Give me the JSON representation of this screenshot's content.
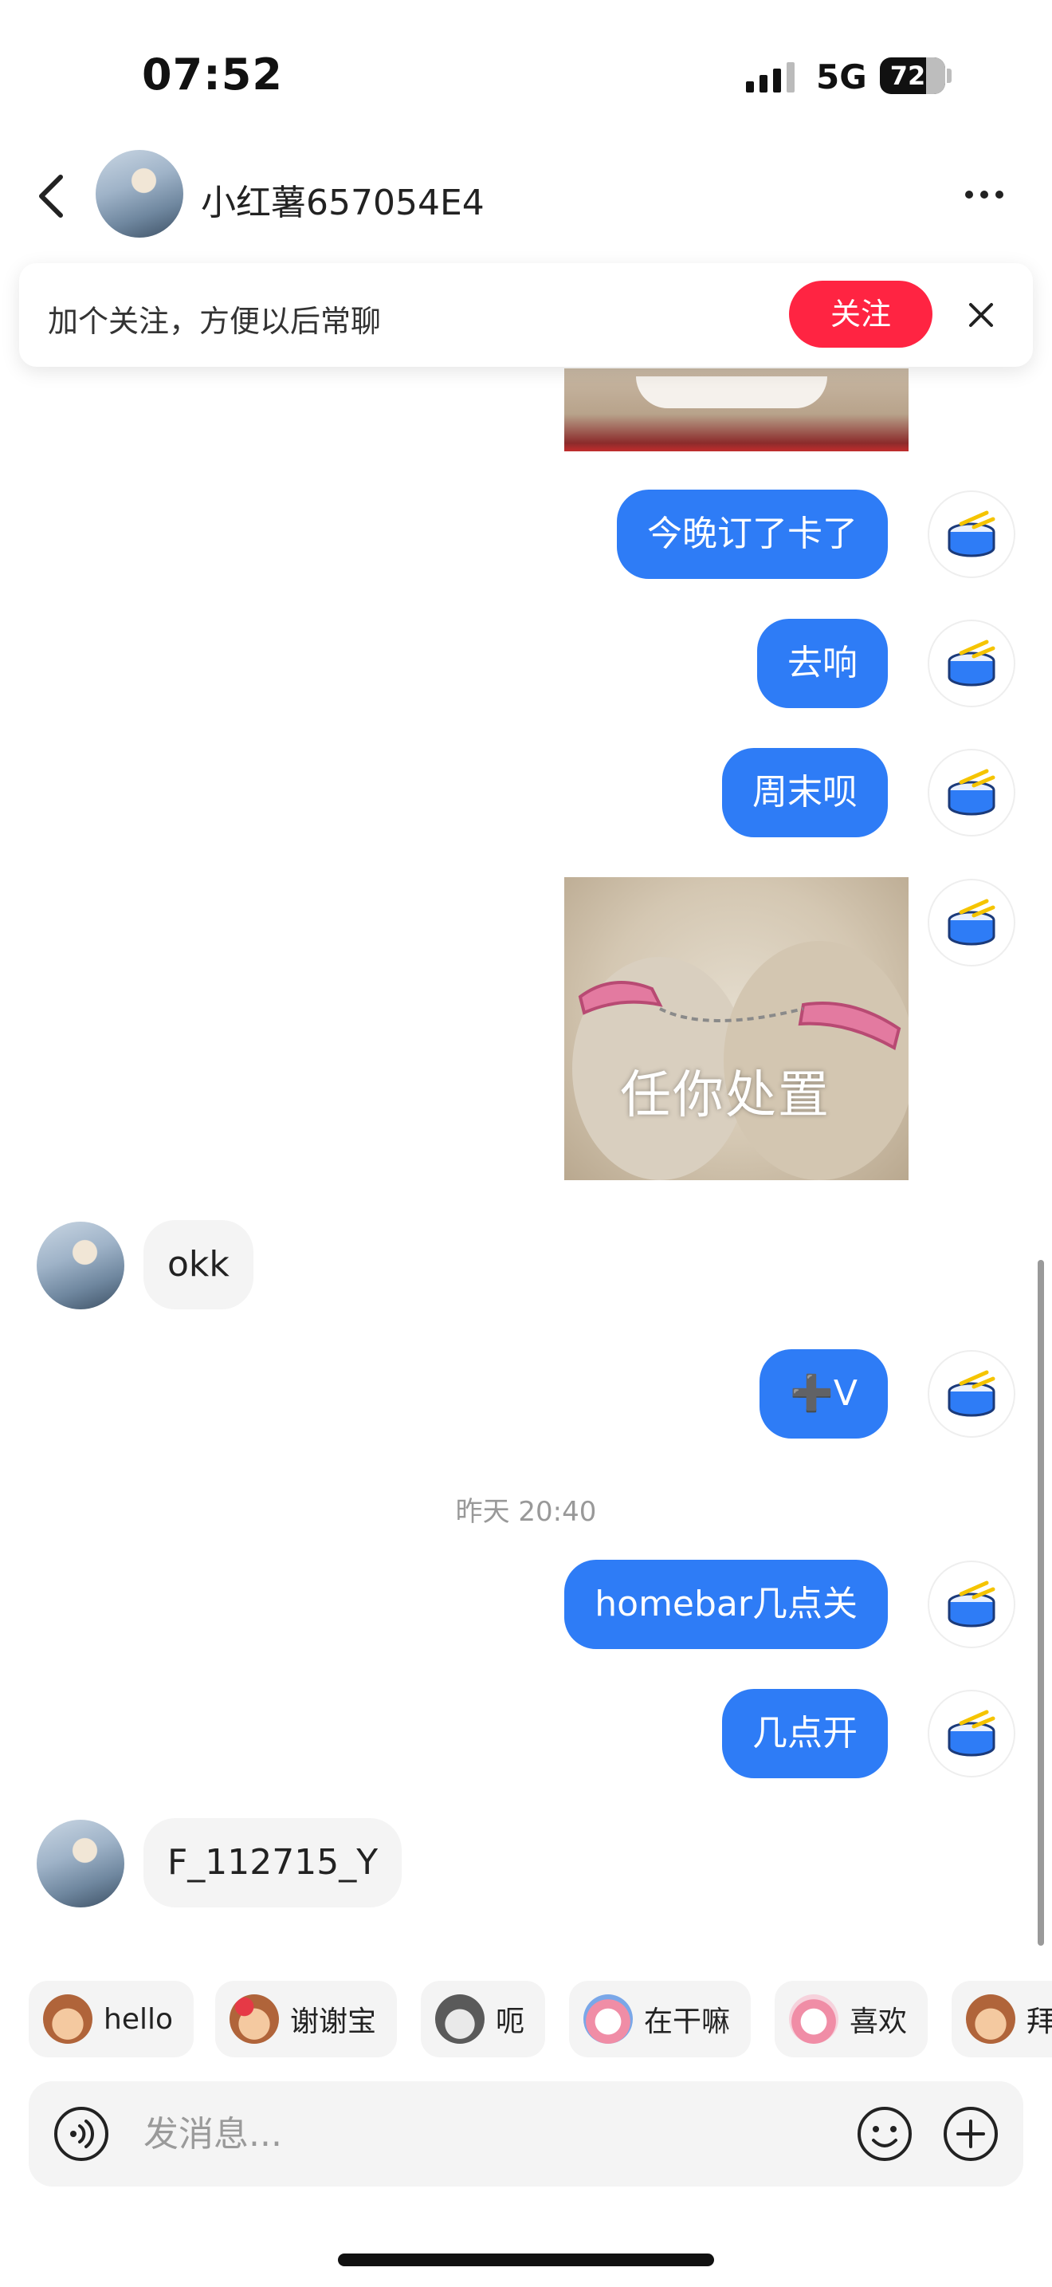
{
  "status_bar": {
    "time": "07:52",
    "network": "5G",
    "battery": "72"
  },
  "header": {
    "title": "小红薯657054E4",
    "back_icon": "chevron-left-icon",
    "more_icon": "more-horizontal-icon"
  },
  "follow_banner": {
    "text": "加个关注，方便以后常聊",
    "button_label": "关注",
    "close_icon": "close-icon"
  },
  "messages": [
    {
      "side": "out",
      "type": "image-crop"
    },
    {
      "side": "out",
      "type": "text",
      "text": "今晚订了卡了"
    },
    {
      "side": "out",
      "type": "text",
      "text": "去响"
    },
    {
      "side": "out",
      "type": "text",
      "text": "周末呗"
    },
    {
      "side": "out",
      "type": "sticker",
      "caption": "任你处置"
    },
    {
      "side": "in",
      "type": "text",
      "text": "okk"
    },
    {
      "side": "out",
      "type": "text",
      "text": "➕V"
    },
    {
      "side": "out",
      "type": "text",
      "text": "homebar几点关"
    },
    {
      "side": "out",
      "type": "text",
      "text": "几点开"
    },
    {
      "side": "in",
      "type": "text",
      "text": "F_112715_Y"
    }
  ],
  "timestamp": "昨天 20:40",
  "quick_replies": [
    {
      "label": "hello",
      "icon": "monkey-emoji-icon"
    },
    {
      "label": "谢谢宝",
      "icon": "monkey-flower-emoji-icon"
    },
    {
      "label": "呃",
      "icon": "cat-emoji-icon"
    },
    {
      "label": "在干嘛",
      "icon": "pink-blob-emoji-icon"
    },
    {
      "label": "喜欢",
      "icon": "pink-blob-heart-emoji-icon"
    },
    {
      "label": "拜",
      "icon": "monkey-bye-emoji-icon"
    }
  ],
  "input": {
    "placeholder": "发消息...",
    "voice_icon": "voice-icon",
    "emoji_icon": "smile-icon",
    "plus_icon": "plus-circle-icon"
  },
  "colors": {
    "accent_blue": "#2e7cf6",
    "follow_red": "#ff2442",
    "bubble_gray": "#f4f4f4"
  }
}
